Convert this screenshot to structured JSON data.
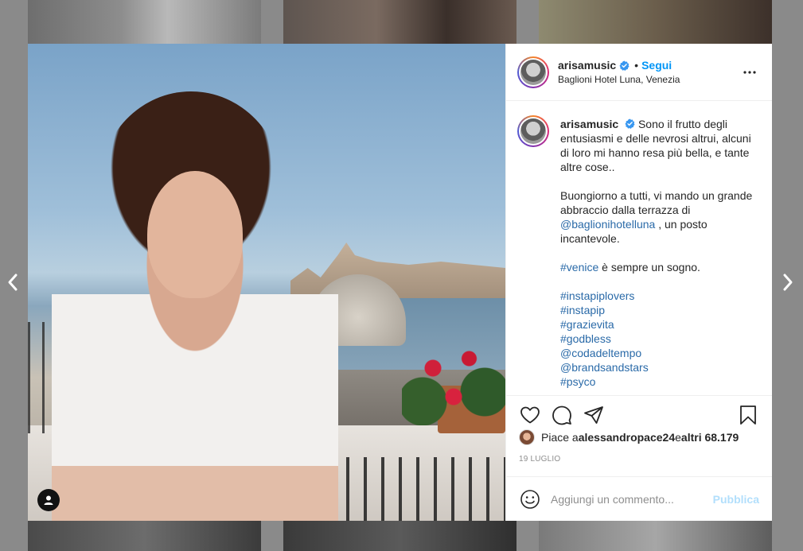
{
  "post": {
    "username": "arisamusic",
    "follow_label": "Segui",
    "separator": "•",
    "location": "Baglioni Hotel Luna, Venezia",
    "caption": {
      "username": "arisamusic",
      "line1": "Sono il frutto degli entusiasmi e delle nevrosi altrui, alcuni di loro mi hanno resa più bella, e tante altre cose..",
      "para2_start": "Buongiorno a tutti, vi mando un grande abbraccio dalla terrazza di ",
      "para2_mention": "@baglionihotelluna",
      "para2_end": " , un posto incantevole.",
      "para3_tag": "#venice",
      "para3_text": " è sempre un sogno.",
      "tags": [
        "#instapiplovers",
        "#instapip",
        "#grazievita",
        "#godbless",
        "@codadeltempo",
        "@brandsandstars",
        "#psyco"
      ]
    },
    "likes": {
      "prefix": "Piace a ",
      "user": "alessandropace24",
      "middle": " e ",
      "others": "altri 68.179"
    },
    "date": "19 LUGLIO",
    "comment_placeholder": "Aggiungi un commento...",
    "publish_label": "Pubblica"
  },
  "icons": {
    "verified": "verified-badge-icon",
    "more": "more-options-icon",
    "like": "heart-icon",
    "comment": "comment-icon",
    "share": "share-icon",
    "save": "bookmark-icon",
    "emoji": "emoji-icon",
    "tagged_user": "user-icon",
    "prev": "chevron-left-icon",
    "next": "chevron-right-icon"
  },
  "colors": {
    "accent": "#0095f6",
    "link": "#2a6aa8",
    "verified": "#3897f0",
    "publish_disabled": "#b2dffc"
  }
}
